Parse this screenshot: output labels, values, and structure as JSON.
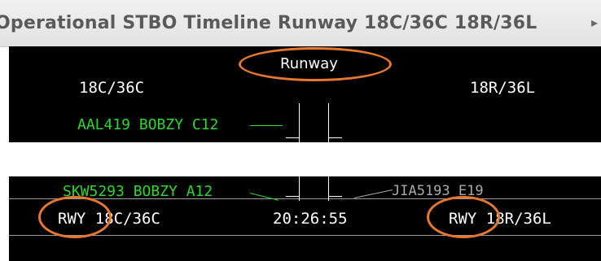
{
  "window": {
    "title": "Operational STBO Timeline Runway 18C/36C 18R/36L",
    "minimize_icon": "minimize-icon",
    "scroll_icon": "scroll-right-icon"
  },
  "timeline": {
    "header_label": "Runway",
    "left_runway": "18C/36C",
    "right_runway": "18R/36L",
    "flights_left": [
      {
        "label": "AAL419 BOBZY C12"
      },
      {
        "label": "SKW5293 BOBZY A12"
      }
    ],
    "flights_right": [
      {
        "label": "JIA5193 E19"
      }
    ],
    "footer": {
      "left_label": "RWY 18C/36C",
      "time": "20:26:55",
      "right_label": "RWY 18R/36L"
    }
  },
  "colors": {
    "panel_background": "#000000",
    "departure_label": "#2bd82b",
    "arrival_label": "#a8a8a8",
    "annotation_circle": "#e8772e"
  }
}
